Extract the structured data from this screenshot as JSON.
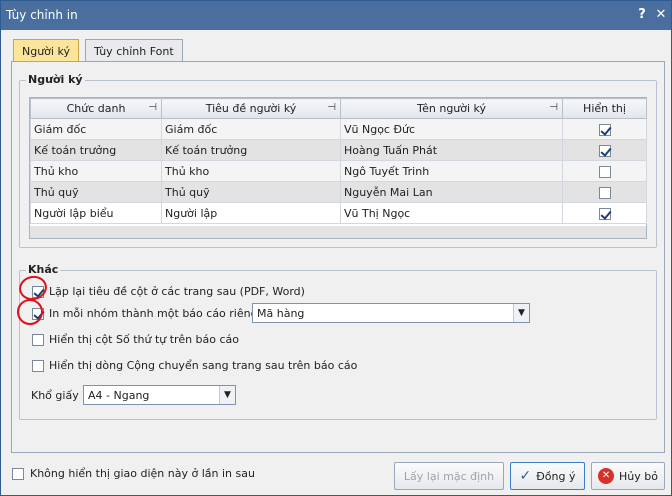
{
  "window": {
    "title": "Tùy chỉnh in",
    "help_glyph": "?",
    "close_glyph": "✕"
  },
  "tabs": [
    {
      "label": "Người ký",
      "active": true
    },
    {
      "label": "Tùy chỉnh Font",
      "active": false
    }
  ],
  "signers": {
    "group_label": "Người ký",
    "columns": [
      "Chức danh",
      "Tiêu đề người ký",
      "Tên người ký",
      "Hiển thị"
    ],
    "rows": [
      {
        "title": "Giám đốc",
        "heading": "Giám đốc",
        "name": "Vũ Ngọc Đức",
        "show": true
      },
      {
        "title": "Kế toán trưởng",
        "heading": "Kế toán trưởng",
        "name": "Hoàng Tuấn Phát",
        "show": true
      },
      {
        "title": "Thủ kho",
        "heading": "Thủ kho",
        "name": "Ngô Tuyết Trinh",
        "show": false
      },
      {
        "title": "Thủ quỹ",
        "heading": "Thủ quỹ",
        "name": "Nguyễn Mai Lan",
        "show": false
      },
      {
        "title": "Người lập biểu",
        "heading": "Người lập",
        "name": "Vũ Thị Ngọc",
        "show": true
      }
    ]
  },
  "other": {
    "group_label": "Khác",
    "options": [
      {
        "label": "Lặp lại tiêu đề cột ở các trang sau (PDF, Word)",
        "checked": true
      },
      {
        "label": "In mỗi nhóm thành một báo cáo riêng",
        "checked": true
      },
      {
        "label": "Hiển thị cột Số thứ tự trên báo cáo",
        "checked": false
      },
      {
        "label": "Hiển thị dòng Cộng chuyển sang trang sau trên báo cáo",
        "checked": false
      }
    ],
    "group_by_value": "Mã hàng",
    "paper_label": "Khổ giấy",
    "paper_value": "A4 - Ngang"
  },
  "footer": {
    "dont_show_label": "Không hiển thị giao diện này ở lần in sau",
    "dont_show_checked": false,
    "reset_label": "Lấy lại mặc định",
    "ok_label": "Đồng ý",
    "cancel_label": "Hủy bỏ"
  },
  "colors": {
    "annotation": "#e0101a",
    "active_tab": "#fbe59b",
    "titlebar": "#4a6f9e"
  }
}
